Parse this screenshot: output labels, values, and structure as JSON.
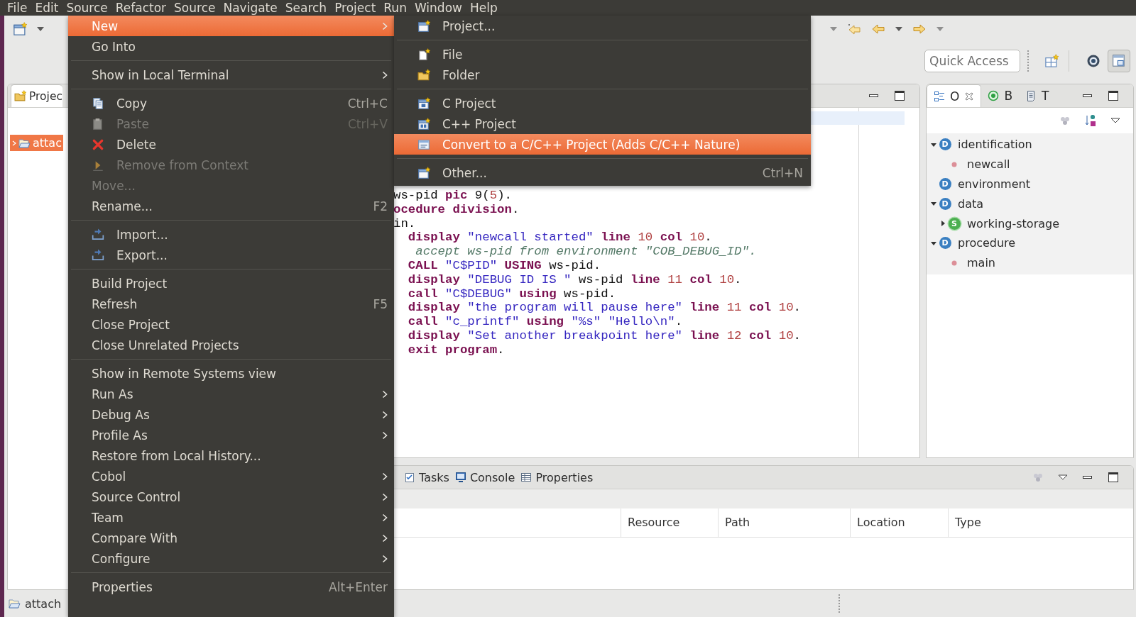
{
  "menu_bar": {
    "items": [
      "File",
      "Edit",
      "Source",
      "Refactor",
      "Source",
      "Navigate",
      "Search",
      "Project",
      "Run",
      "Window",
      "Help"
    ]
  },
  "toolbar": {
    "quick_access": {
      "placeholder": "Quick Access"
    },
    "perspectives": [
      {
        "selected": false
      },
      {
        "selected": true
      }
    ]
  },
  "project_explorer": {
    "tab": {
      "label": "Projec",
      "selected": true
    },
    "tree": [
      {
        "label": "attac",
        "selected": true,
        "expanded": false
      }
    ]
  },
  "editor": {
    "code_lines": [
      [
        {
          "kind": "plain",
          "text": "ws-pid"
        },
        {
          "kind": "keyword",
          "text": " pic"
        },
        {
          "kind": "plain",
          "text": " 9("
        },
        {
          "kind": "number",
          "text": "5"
        },
        {
          "kind": "plain",
          "text": ")."
        }
      ],
      [
        {
          "kind": "keyword",
          "text": "ocedure division"
        },
        {
          "kind": "plain",
          "text": "."
        }
      ],
      [
        {
          "kind": "plain",
          "text": "in."
        }
      ],
      [
        {
          "kind": "keyword",
          "text": "  display"
        },
        {
          "kind": "string",
          "text": " \"newcall started\""
        },
        {
          "kind": "keyword",
          "text": " line"
        },
        {
          "kind": "number",
          "text": " 10"
        },
        {
          "kind": "keyword",
          "text": " col"
        },
        {
          "kind": "number",
          "text": " 10"
        },
        {
          "kind": "plain",
          "text": "."
        }
      ],
      [
        {
          "kind": "comment",
          "text": "   accept ws-pid from environment \"COB_DEBUG_ID\"."
        }
      ],
      [
        {
          "kind": "keyword",
          "text": "  CALL"
        },
        {
          "kind": "string",
          "text": " \"C$PID\""
        },
        {
          "kind": "keyword",
          "text": " USING"
        },
        {
          "kind": "plain",
          "text": " ws-pid."
        }
      ],
      [
        {
          "kind": "keyword",
          "text": "  display"
        },
        {
          "kind": "string",
          "text": " \"DEBUG ID IS \""
        },
        {
          "kind": "plain",
          "text": " ws-pid"
        },
        {
          "kind": "keyword",
          "text": " line"
        },
        {
          "kind": "number",
          "text": " 11"
        },
        {
          "kind": "keyword",
          "text": " col"
        },
        {
          "kind": "number",
          "text": " 10"
        },
        {
          "kind": "plain",
          "text": "."
        }
      ],
      [
        {
          "kind": "keyword",
          "text": "  call"
        },
        {
          "kind": "string",
          "text": " \"C$DEBUG\""
        },
        {
          "kind": "keyword",
          "text": " using"
        },
        {
          "kind": "plain",
          "text": " ws-pid."
        }
      ],
      [
        {
          "kind": "keyword",
          "text": "  display"
        },
        {
          "kind": "string",
          "text": " \"the program will pause here\""
        },
        {
          "kind": "keyword",
          "text": " line"
        },
        {
          "kind": "number",
          "text": " 11"
        },
        {
          "kind": "keyword",
          "text": " col"
        },
        {
          "kind": "number",
          "text": " 10"
        },
        {
          "kind": "plain",
          "text": "."
        }
      ],
      [
        {
          "kind": "keyword",
          "text": "  call"
        },
        {
          "kind": "string",
          "text": " \"c_printf\""
        },
        {
          "kind": "keyword",
          "text": " using"
        },
        {
          "kind": "string",
          "text": " \"%s\""
        },
        {
          "kind": "string",
          "text": " \"Hello\\n\""
        },
        {
          "kind": "plain",
          "text": "."
        }
      ],
      [
        {
          "kind": "keyword",
          "text": "  display"
        },
        {
          "kind": "string",
          "text": " \"Set another breakpoint here\""
        },
        {
          "kind": "keyword",
          "text": " line"
        },
        {
          "kind": "number",
          "text": " 12"
        },
        {
          "kind": "keyword",
          "text": " col"
        },
        {
          "kind": "number",
          "text": " 10"
        },
        {
          "kind": "plain",
          "text": "."
        }
      ],
      [
        {
          "kind": "keyword",
          "text": "  exit program"
        },
        {
          "kind": "plain",
          "text": "."
        }
      ]
    ]
  },
  "outline": {
    "tabs": [
      {
        "label": "O",
        "selected": true
      },
      {
        "label": "B",
        "selected": false
      },
      {
        "label": "T",
        "selected": false
      }
    ],
    "tree": [
      {
        "label": "identification",
        "badge": "D",
        "kind": "division",
        "expanded": true,
        "children": [
          {
            "label": "newcall",
            "kind": "paragraph"
          }
        ]
      },
      {
        "label": "environment",
        "badge": "D",
        "kind": "division"
      },
      {
        "label": "data",
        "badge": "D",
        "kind": "division",
        "expanded": true,
        "children": [
          {
            "label": "working-storage",
            "badge": "S",
            "kind": "section",
            "expanded": false
          }
        ]
      },
      {
        "label": "procedure",
        "badge": "D",
        "kind": "division",
        "expanded": true,
        "children": [
          {
            "label": "main",
            "kind": "paragraph"
          }
        ]
      }
    ]
  },
  "bottom_panel": {
    "tabs": [
      {
        "label": "Tasks",
        "selected": false
      },
      {
        "label": "Console",
        "selected": false
      },
      {
        "label": "Properties",
        "selected": false
      }
    ],
    "table": {
      "columns": [
        "Resource",
        "Path",
        "Location",
        "Type"
      ]
    }
  },
  "status_bar": {
    "text": "attach"
  },
  "context_menu": {
    "groups": [
      {
        "items": [
          {
            "label": "New",
            "has_submenu": true,
            "disabled": false,
            "selected": true
          },
          {
            "label": "Go Into",
            "has_submenu": false,
            "disabled": false,
            "selected": false
          }
        ]
      },
      {
        "items": [
          {
            "label": "Show in Local Terminal",
            "has_submenu": true,
            "disabled": false,
            "selected": false
          }
        ]
      },
      {
        "items": [
          {
            "label": "Copy",
            "shortcut": "Ctrl+C",
            "has_submenu": false,
            "disabled": false,
            "selected": false
          },
          {
            "label": "Paste",
            "shortcut": "Ctrl+V",
            "has_submenu": false,
            "disabled": true,
            "selected": false
          },
          {
            "label": "Delete",
            "has_submenu": false,
            "disabled": false,
            "selected": false
          },
          {
            "label": "Remove from Context",
            "has_submenu": false,
            "disabled": true,
            "selected": false
          },
          {
            "label": "Move...",
            "has_submenu": false,
            "disabled": true,
            "selected": false
          },
          {
            "label": "Rename...",
            "shortcut": "F2",
            "has_submenu": false,
            "disabled": false,
            "selected": false
          }
        ]
      },
      {
        "items": [
          {
            "label": "Import...",
            "has_submenu": false,
            "disabled": false,
            "selected": false
          },
          {
            "label": "Export...",
            "has_submenu": false,
            "disabled": false,
            "selected": false
          }
        ]
      },
      {
        "items": [
          {
            "label": "Build Project",
            "has_submenu": false,
            "disabled": false,
            "selected": false
          },
          {
            "label": "Refresh",
            "shortcut": "F5",
            "has_submenu": false,
            "disabled": false,
            "selected": false
          },
          {
            "label": "Close Project",
            "has_submenu": false,
            "disabled": false,
            "selected": false
          },
          {
            "label": "Close Unrelated Projects",
            "has_submenu": false,
            "disabled": false,
            "selected": false
          }
        ]
      },
      {
        "items": [
          {
            "label": "Show in Remote Systems view",
            "has_submenu": false,
            "disabled": false,
            "selected": false
          },
          {
            "label": "Run As",
            "has_submenu": true,
            "disabled": false,
            "selected": false
          },
          {
            "label": "Debug As",
            "has_submenu": true,
            "disabled": false,
            "selected": false
          },
          {
            "label": "Profile As",
            "has_submenu": true,
            "disabled": false,
            "selected": false
          },
          {
            "label": "Restore from Local History...",
            "has_submenu": false,
            "disabled": false,
            "selected": false
          },
          {
            "label": "Cobol",
            "has_submenu": true,
            "disabled": false,
            "selected": false
          },
          {
            "label": "Source Control",
            "has_submenu": true,
            "disabled": false,
            "selected": false
          },
          {
            "label": "Team",
            "has_submenu": true,
            "disabled": false,
            "selected": false
          },
          {
            "label": "Compare With",
            "has_submenu": true,
            "disabled": false,
            "selected": false
          },
          {
            "label": "Configure",
            "has_submenu": true,
            "disabled": false,
            "selected": false
          }
        ]
      },
      {
        "items": [
          {
            "label": "Properties",
            "shortcut": "Alt+Enter",
            "has_submenu": false,
            "disabled": false,
            "selected": false
          }
        ]
      }
    ]
  },
  "submenu": {
    "groups": [
      {
        "items": [
          {
            "label": "Project...",
            "selected": false
          }
        ]
      },
      {
        "items": [
          {
            "label": "File",
            "selected": false
          },
          {
            "label": "Folder",
            "selected": false
          }
        ]
      },
      {
        "items": [
          {
            "label": "C Project",
            "selected": false
          },
          {
            "label": "C++ Project",
            "selected": false
          },
          {
            "label": "Convert to a C/C++ Project (Adds C/C++ Nature)",
            "selected": true
          }
        ]
      },
      {
        "items": [
          {
            "label": "Other...",
            "shortcut": "Ctrl+N",
            "selected": false
          }
        ]
      }
    ]
  }
}
